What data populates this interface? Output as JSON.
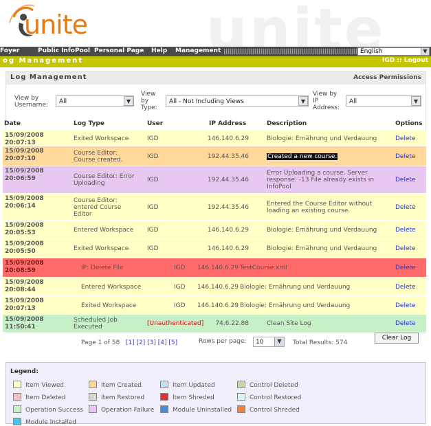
{
  "header": {
    "logo_text": "unite",
    "watermark": "unite"
  },
  "nav": {
    "items": [
      "Foyer",
      "Public InfoPool",
      "Personal Page",
      "Help",
      "Management"
    ],
    "language": "English"
  },
  "topbar": {
    "title": "og Management",
    "user": "IGD",
    "separator": " :: ",
    "logout": "Logout"
  },
  "panel": {
    "title": "Log Management",
    "access": "Access Permissions"
  },
  "filters": {
    "username_label": "View by Username:",
    "username_value": "All",
    "type_label": "View by Type:",
    "type_value": "All - Not Including Views",
    "ip_label": "View by IP Address:",
    "ip_value": "All"
  },
  "table": {
    "headers": [
      "Date",
      "Log Type",
      "User",
      "IP Address",
      "Description",
      "Options"
    ],
    "rows": [
      {
        "date": "15/09/2008\n20:07:13",
        "type": "Exited Workspace",
        "user": "IGD",
        "ip": "146.140.6.29",
        "desc": "Biologie: Ernährung und Verdauung",
        "option": "Delete",
        "color": "#ffffc6"
      },
      {
        "date": "15/09/2008\n20:07:10",
        "type": "Course Editor:\nCourse created.",
        "user": "IGD",
        "ip": "192.44.35.46",
        "desc": "Created a new course.",
        "option": "Delete",
        "color": "#ffd89a"
      },
      {
        "date": "15/09/2008\n20:06:59",
        "type": "Course Editor: Error\nUploading",
        "user": "IGD",
        "ip": "192.44.35.46",
        "desc": "Error Uploading a course. Server\nresponse: -13 File already exists in\nInfoPool",
        "option": "Delete",
        "color": "#e8c8f0"
      },
      {
        "date": "15/09/2008\n20:06:14",
        "type": "Course Editor:\nentered Course\nEditor",
        "user": "IGD",
        "ip": "192.44.35.46",
        "desc": "Entered the Course Editor without\nloading an existing course.",
        "option": "Delete",
        "color": "#ffffc6"
      },
      {
        "date": "15/09/2008\n20:05:53",
        "type": "Entered Workspace",
        "user": "IGD",
        "ip": "146.140.6.29",
        "desc": "Biologie: Ernährung und Verdauung",
        "option": "Delete",
        "color": "#ffffc6"
      },
      {
        "date": "15/09/2008\n20:05:50",
        "type": "Exited Workspace",
        "user": "IGD",
        "ip": "146.140.6.29",
        "desc": "Biologie: Ernährung und Verdauung",
        "option": "Delete",
        "color": "#ffffc6"
      },
      {
        "date": "15/09/2008\n20:08:59",
        "type": "IP: Delete File",
        "user": "IGD",
        "ip": "146.140.6.29",
        "desc": "TestCourse.xml",
        "option": "Delete",
        "color": "#ff6a6a"
      },
      {
        "date": "15/09/2008\n20:08:44",
        "type": "Entered Workspace",
        "user": "IGD",
        "ip": "146.140.6.29",
        "desc": "Biologie: Ernährung und Verdauung",
        "option": "Delete",
        "color": "#ffffc6"
      },
      {
        "date": "15/09/2008\n20:07:13",
        "type": "Exited Workspace",
        "user": "IGD",
        "ip": "146.140.6.29",
        "desc": "Biologie: Ernährung und Verdauung",
        "option": "Delete",
        "color": "#ffffc6"
      },
      {
        "date": "15/09/2008\n11:50:41",
        "type": "Scheduled Job\nExecuted",
        "user": "[Unauthenticated]",
        "ip": "74.6.22.88",
        "desc": "Clean Site Log",
        "option": "Delete",
        "color": "#c6f0c6"
      }
    ]
  },
  "pager": {
    "text": "Page 1 of 58",
    "pages": [
      "[1]",
      "[2]",
      "[3]",
      "[4]",
      "[5]"
    ],
    "rows_label": "Rows per page:",
    "rows_value": "10",
    "total": "Total Results: 574",
    "clear": "Clear Log"
  },
  "legend": {
    "title": "Legend:",
    "items": [
      {
        "label": "Item Viewed",
        "color": "#ffffc6"
      },
      {
        "label": "Item Created",
        "color": "#ffd89a"
      },
      {
        "label": "Item Updated",
        "color": "#c6dcf4"
      },
      {
        "label": "Control Deleted",
        "color": "#c6d8a8"
      },
      {
        "label": "Item Deleted",
        "color": "#f4c4c4"
      },
      {
        "label": "Item Restored",
        "color": "#d8d8d8"
      },
      {
        "label": "Item Shreded",
        "color": "#e03030"
      },
      {
        "label": "Control Restored",
        "color": "#d8f4f4"
      },
      {
        "label": "Operation Success",
        "color": "#c6f0c6"
      },
      {
        "label": "Operation Failure",
        "color": "#e8c8f0"
      },
      {
        "label": "Module Uninstalled",
        "color": "#4a88d8"
      },
      {
        "label": "Control Shreded",
        "color": "#f08040"
      },
      {
        "label": "Module Installed",
        "color": "#40c8e8"
      }
    ]
  }
}
